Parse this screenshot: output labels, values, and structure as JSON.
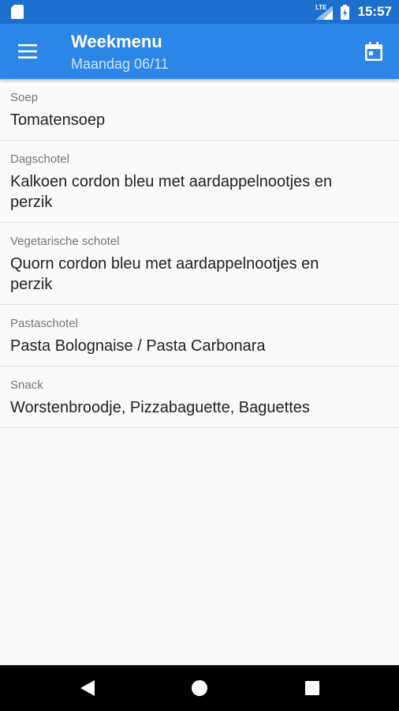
{
  "status_bar": {
    "network_label": "LTE",
    "time": "15:57"
  },
  "app_bar": {
    "title": "Weekmenu",
    "subtitle": "Maandag 06/11",
    "menu_icon": "hamburger-menu-icon",
    "calendar_icon": "calendar-icon"
  },
  "menu": {
    "items": [
      {
        "label": "Soep",
        "value": "Tomatensoep"
      },
      {
        "label": "Dagschotel",
        "value": "Kalkoen cordon bleu met aardappelnootjes en perzik"
      },
      {
        "label": "Vegetarische schotel",
        "value": "Quorn cordon bleu met aardappelnootjes en perzik"
      },
      {
        "label": "Pastaschotel",
        "value": "Pasta Bolognaise / Pasta Carbonara"
      },
      {
        "label": "Snack",
        "value": "Worstenbroodje, Pizzabaguette, Baguettes"
      }
    ]
  },
  "nav_bar": {
    "back_icon": "back-triangle-icon",
    "home_icon": "home-circle-icon",
    "recents_icon": "recents-square-icon"
  },
  "colors": {
    "status_bar": "#1a6fcf",
    "app_bar": "#2b86e8",
    "background": "#fafafa",
    "label": "#757575",
    "value": "#212121"
  }
}
